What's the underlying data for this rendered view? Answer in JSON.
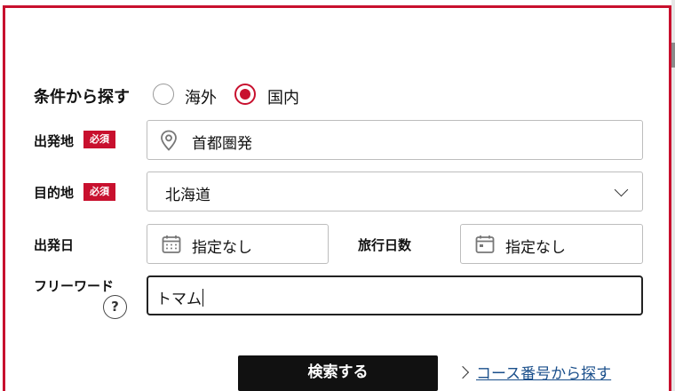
{
  "search_form": {
    "heading": "条件から探す",
    "region_options": [
      {
        "label": "海外",
        "selected": false
      },
      {
        "label": "国内",
        "selected": true
      }
    ],
    "required_badge": "必須",
    "departure": {
      "label": "出発地",
      "value": "首都圏発",
      "icon": "location-pin-icon"
    },
    "destination": {
      "label": "目的地",
      "value": "北海道",
      "icon": "chevron-down-icon"
    },
    "departure_date": {
      "label": "出発日",
      "value": "指定なし",
      "icon": "calendar-icon"
    },
    "trip_days": {
      "label": "旅行日数",
      "value": "指定なし",
      "icon": "calendar-icon"
    },
    "free_word": {
      "label": "フリーワード",
      "value": "トマム",
      "help": "?"
    },
    "search_button": "検索する",
    "course_link": "コース番号から探す"
  },
  "colors": {
    "accent": "#c8102e",
    "link": "#1a4f8b",
    "button": "#111111"
  }
}
